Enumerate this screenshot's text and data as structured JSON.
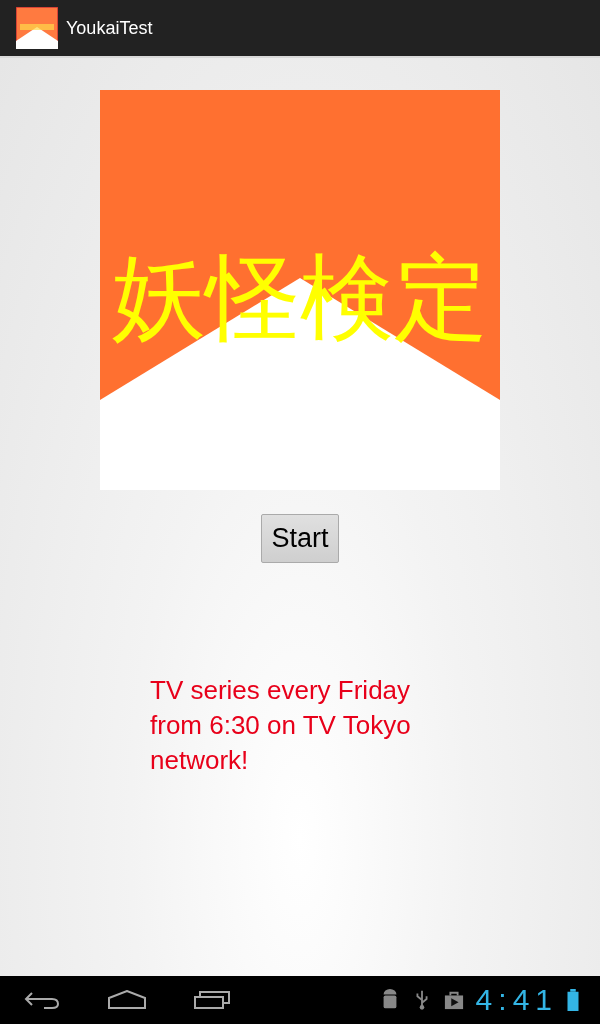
{
  "action_bar": {
    "title": "YoukaiTest"
  },
  "banner": {
    "title": "妖怪検定"
  },
  "start_button": {
    "label": "Start"
  },
  "message": "TV series every Friday from 6:30 on TV Tokyo network!",
  "status_bar": {
    "time": "4:41"
  }
}
